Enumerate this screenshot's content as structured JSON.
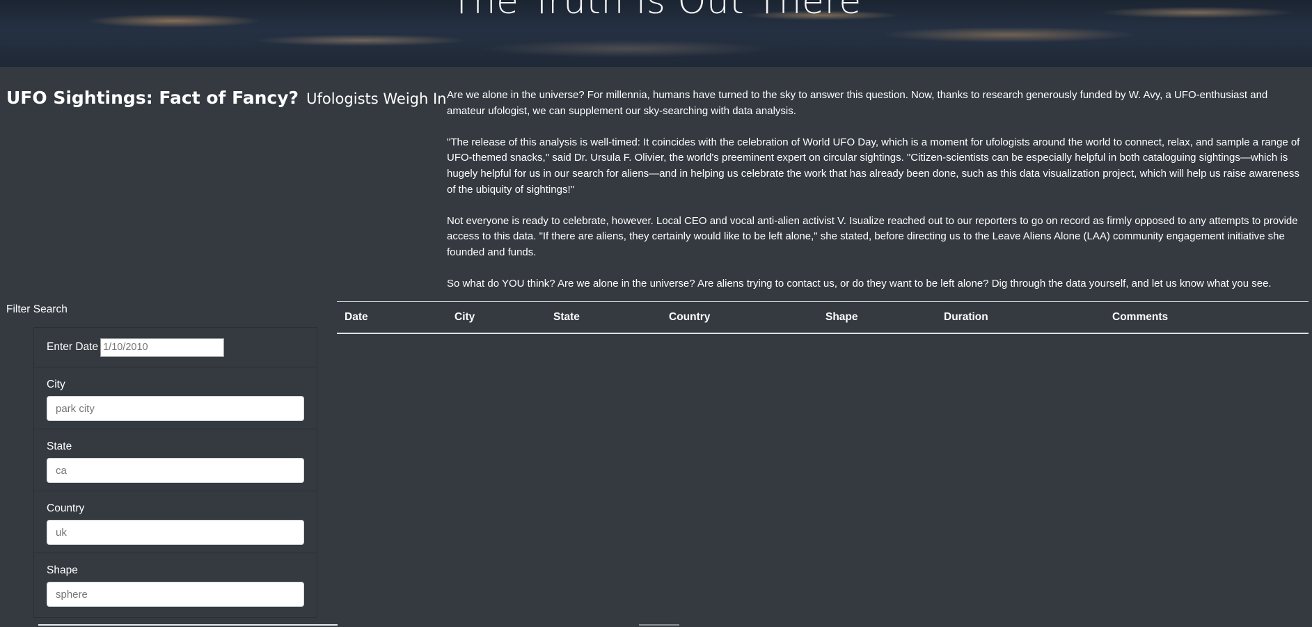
{
  "hero": {
    "title": "The Truth is Out There"
  },
  "headline": {
    "main": "UFO Sightings: Fact of Fancy?",
    "sub": "Ufologists Weigh In"
  },
  "article": {
    "paragraphs": [
      "Are we alone in the universe? For millennia, humans have turned to the sky to answer this question. Now, thanks to research generously funded by W. Avy, a UFO-enthusiast and amateur ufologist, we can supplement our sky-searching with data analysis.",
      "\"The release of this analysis is well-timed: It coincides with the celebration of World UFO Day, which is a moment for ufologists around the world to connect, relax, and sample a range of UFO-themed snacks,\" said Dr. Ursula F. Olivier, the world's preeminent expert on circular sightings. \"Citizen-scientists can be especially helpful in both cataloguing sightings—which is hugely helpful for us in our search for aliens—and in helping us celebrate the work that has already been done, such as this data visualization project, which will help us raise awareness of the ubiquity of sightings!\"",
      "Not everyone is ready to celebrate, however. Local CEO and vocal anti-alien activist V. Isualize reached out to our reporters to go on record as firmly opposed to any attempts to provide access to this data. \"If there are aliens, they certainly would like to be left alone,\" she stated, before directing us to the Leave Aliens Alone (LAA) community engagement initiative she founded and funds.",
      "So what do YOU think? Are we alone in the universe? Are aliens trying to contact us, or do they want to be left alone? Dig through the data yourself, and let us know what you see."
    ]
  },
  "filters": {
    "title": "Filter Search",
    "date": {
      "label": "Enter Date",
      "placeholder": "1/10/2010"
    },
    "city": {
      "label": "City",
      "placeholder": "park city"
    },
    "state": {
      "label": "State",
      "placeholder": "ca"
    },
    "country": {
      "label": "Country",
      "placeholder": "uk"
    },
    "shape": {
      "label": "Shape",
      "placeholder": "sphere"
    }
  },
  "table": {
    "headers": [
      "Date",
      "City",
      "State",
      "Country",
      "Shape",
      "Duration",
      "Comments"
    ],
    "rows": []
  }
}
